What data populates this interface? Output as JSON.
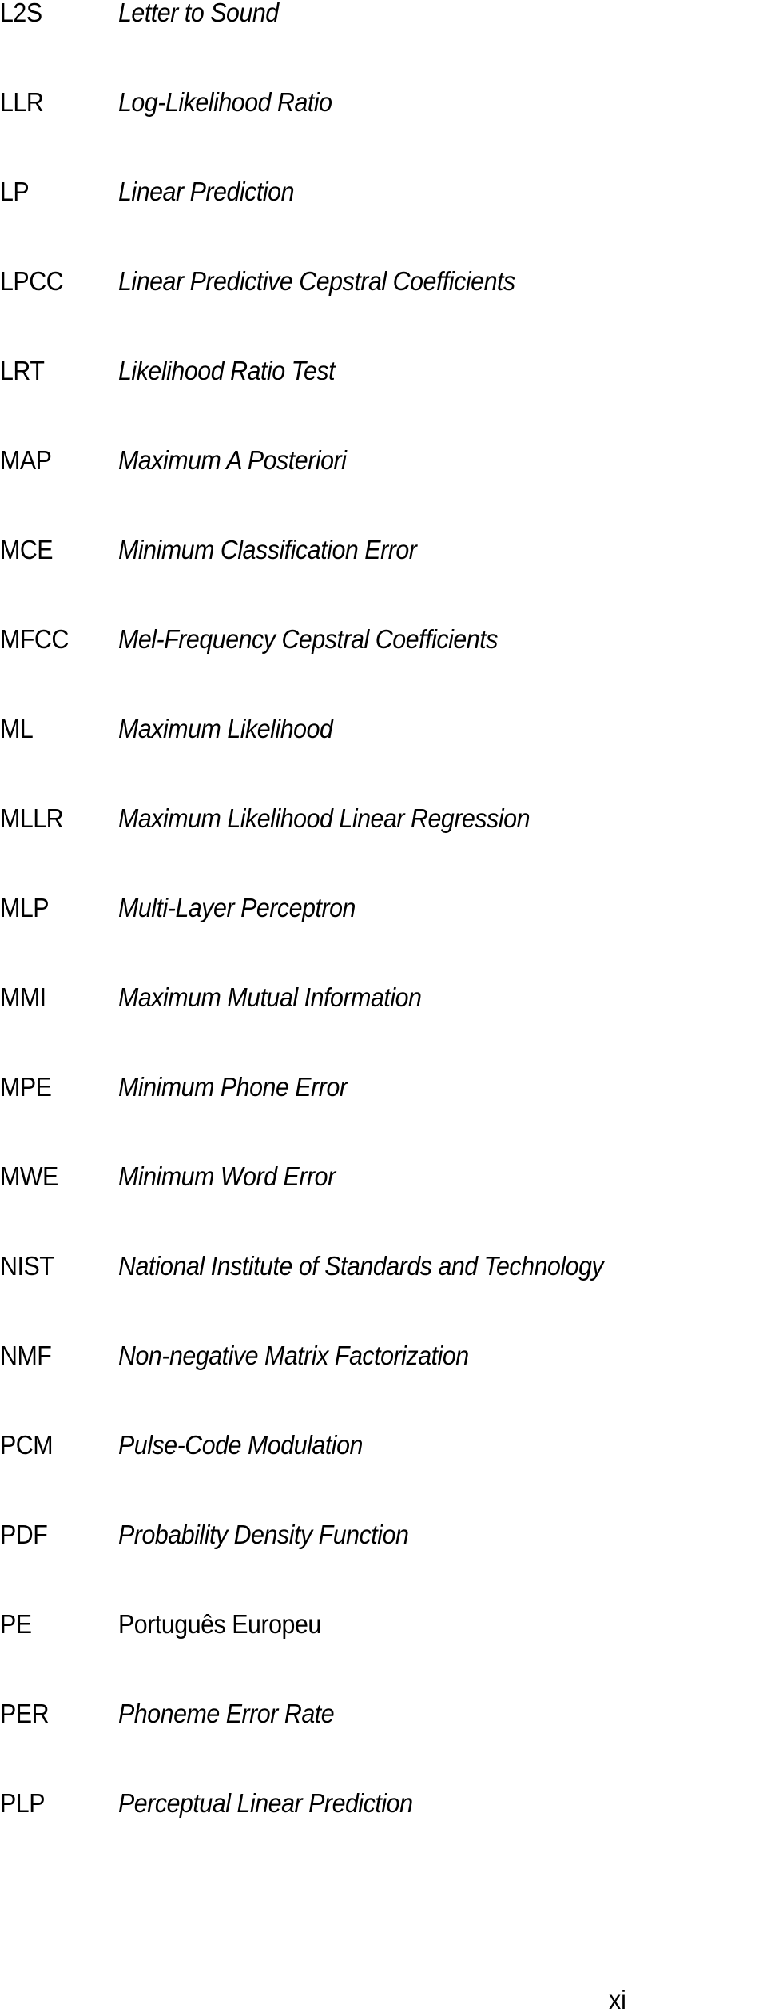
{
  "entries": [
    {
      "abbr": "L2S",
      "term": "Letter to Sound",
      "italic": true
    },
    {
      "abbr": "LLR",
      "term": "Log-Likelihood Ratio",
      "italic": true
    },
    {
      "abbr": "LP",
      "term": "Linear Prediction",
      "italic": true
    },
    {
      "abbr": "LPCC",
      "term": "Linear Predictive Cepstral Coefficients",
      "italic": true
    },
    {
      "abbr": "LRT",
      "term": "Likelihood Ratio Test",
      "italic": true
    },
    {
      "abbr": "MAP",
      "term": "Maximum A Posteriori",
      "italic": true
    },
    {
      "abbr": "MCE",
      "term": "Minimum Classification Error",
      "italic": true
    },
    {
      "abbr": "MFCC",
      "term": "Mel-Frequency Cepstral Coefficients",
      "italic": true
    },
    {
      "abbr": "ML",
      "term": "Maximum Likelihood",
      "italic": true
    },
    {
      "abbr": "MLLR",
      "term": "Maximum Likelihood Linear Regression",
      "italic": true
    },
    {
      "abbr": "MLP",
      "term": "Multi-Layer Perceptron",
      "italic": true
    },
    {
      "abbr": "MMI",
      "term": "Maximum Mutual Information",
      "italic": true
    },
    {
      "abbr": "MPE",
      "term": "Minimum Phone Error",
      "italic": true
    },
    {
      "abbr": "MWE",
      "term": "Minimum Word Error",
      "italic": true
    },
    {
      "abbr": "NIST",
      "term": "National Institute of Standards and Technology",
      "italic": true
    },
    {
      "abbr": "NMF",
      "term": "Non-negative Matrix Factorization",
      "italic": true
    },
    {
      "abbr": "PCM",
      "term": "Pulse-Code Modulation",
      "italic": true
    },
    {
      "abbr": "PDF",
      "term": "Probability Density Function",
      "italic": true
    },
    {
      "abbr": "PE",
      "term": "Português Europeu",
      "italic": false
    },
    {
      "abbr": "PER",
      "term": "Phoneme Error Rate",
      "italic": true
    },
    {
      "abbr": "PLP",
      "term": "Perceptual Linear Prediction",
      "italic": true
    }
  ],
  "page_number": "xi"
}
